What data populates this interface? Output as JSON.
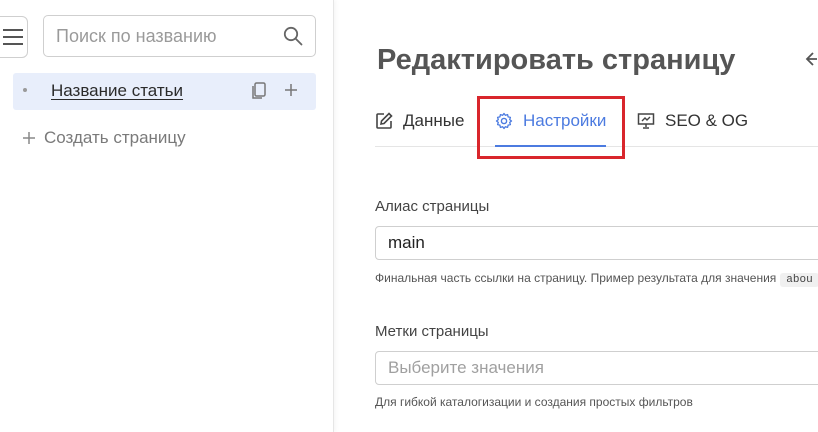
{
  "sidebar": {
    "menu_icon": "hamburger-icon",
    "search": {
      "placeholder": "Поиск по названию",
      "value": "",
      "icon": "search-icon"
    },
    "tree": [
      {
        "label": "Название статьи",
        "selected": true,
        "icons": [
          "copy-icon",
          "plus-icon"
        ]
      }
    ],
    "create_page_label": "Создать страницу"
  },
  "main": {
    "title": "Редактировать страницу",
    "tabs": [
      {
        "label": "Данные",
        "icon": "edit-icon",
        "active": false
      },
      {
        "label": "Настройки",
        "icon": "gear-icon",
        "active": true
      },
      {
        "label": "SEO & OG",
        "icon": "presentation-icon",
        "active": false
      }
    ],
    "fields": {
      "alias": {
        "label": "Алиас страницы",
        "value": "main",
        "hint": "Финальная часть ссылки на страницу. Пример результата для значения",
        "hint_code": "abou"
      },
      "tags": {
        "label": "Метки страницы",
        "placeholder": "Выберите значения",
        "hint": "Для гибкой каталогизации и создания простых фильтров"
      }
    }
  },
  "colors": {
    "accent": "#4c7be0",
    "highlight": "#d9262c",
    "selected_bg": "#e8eefb"
  }
}
